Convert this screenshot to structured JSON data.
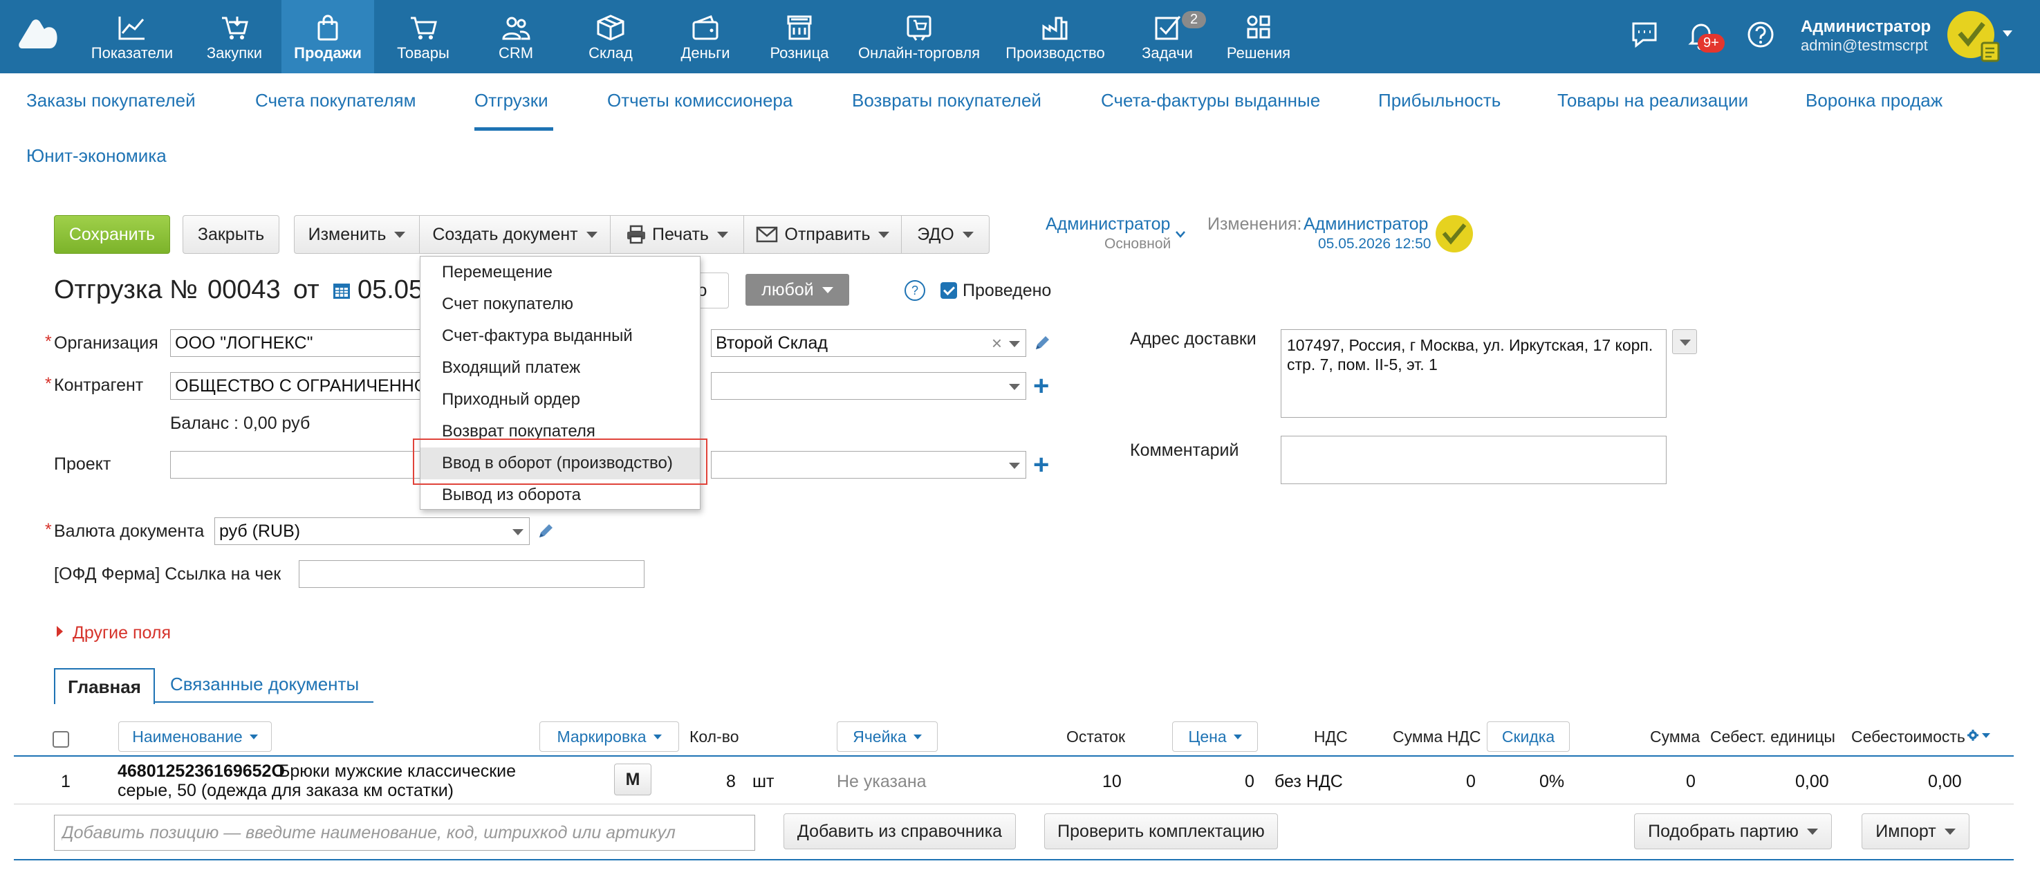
{
  "topnav": {
    "items": [
      {
        "label": "Показатели",
        "icon": "chart-line-icon"
      },
      {
        "label": "Закупки",
        "icon": "cart-arrow-icon"
      },
      {
        "label": "Продажи",
        "icon": "shopping-bag-icon",
        "active": true
      },
      {
        "label": "Товары",
        "icon": "cart-icon"
      },
      {
        "label": "CRM",
        "icon": "users-icon"
      },
      {
        "label": "Склад",
        "icon": "box-icon"
      },
      {
        "label": "Деньги",
        "icon": "wallet-icon"
      },
      {
        "label": "Розница",
        "icon": "store-icon"
      },
      {
        "label": "Онлайн-торговля",
        "icon": "online-store-icon"
      },
      {
        "label": "Производство",
        "icon": "factory-icon"
      },
      {
        "label": "Задачи",
        "icon": "task-check-icon",
        "badge": "2"
      },
      {
        "label": "Решения",
        "icon": "apps-grid-icon"
      }
    ],
    "notifications_badge": "9+",
    "user": {
      "name": "Администратор",
      "email": "admin@testmscrpt"
    },
    "colors": {
      "bar": "#1f6fa4",
      "active": "#2f84bd",
      "badge_red": "#e4362e"
    }
  },
  "subnav": {
    "items": [
      "Заказы покупателей",
      "Счета покупателям",
      "Отгрузки",
      "Отчеты комиссионера",
      "Возвраты покупателей",
      "Счета-фактуры выданные",
      "Прибыльность",
      "Товары на реализации",
      "Воронка продаж",
      "Юнит-экономика"
    ],
    "active": "Отгрузки"
  },
  "toolbar": {
    "save": "Сохранить",
    "close": "Закрыть",
    "edit": "Изменить",
    "create_doc": "Создать документ",
    "print": "Печать",
    "send": "Отправить",
    "edo": "ЭДО"
  },
  "owner": {
    "name": "Администратор",
    "role": "Основной"
  },
  "changes": {
    "label": "Изменения:",
    "name": "Администратор",
    "date": "05.05.2026 12:50"
  },
  "doc": {
    "title": "Отгрузка №",
    "number": "00043",
    "from": "от",
    "date": "05.05",
    "partial_button": "но",
    "status": "любой",
    "posted_label": "Проведено",
    "posted": true
  },
  "form": {
    "org_label": "Организация",
    "org_value": "ООО \"ЛОГНЕКС\"",
    "warehouse_value": "Второй Склад",
    "contractor_label": "Контрагент",
    "contractor_value": "ОБЩЕСТВО С ОГРАНИЧЕННОЙ",
    "balance": "Баланс : 0,00 руб",
    "project_label": "Проект",
    "currency_label": "Валюта документа",
    "currency_value": "руб (RUB)",
    "ofd_label": "[ОФД Ферма] Ссылка на чек",
    "delivery_label": "Адрес доставки",
    "delivery_value": "107497, Россия, г Москва, ул. Иркутская, 17 корп. стр. 7, пом. II-5, эт. 1",
    "comment_label": "Комментарий",
    "other_fields": "Другие поля"
  },
  "tabs": {
    "main": "Главная",
    "related": "Связанные документы"
  },
  "table": {
    "headers": {
      "name": "Наименование",
      "marking": "Маркировка",
      "qty": "Кол-во",
      "cell": "Ячейка",
      "stock": "Остаток",
      "price": "Цена",
      "vat": "НДС",
      "vat_sum": "Сумма НДС",
      "discount": "Скидка",
      "sum": "Сумма",
      "unit_cost": "Себест. единицы",
      "cost": "Себестоимость"
    },
    "rows": [
      {
        "num": "1",
        "code": "4680125236169652О",
        "name_line1": "Брюки мужские классические",
        "name_line2": "серые, 50 (одежда для заказа км остатки)",
        "marking": "М",
        "qty": "8",
        "unit": "шт",
        "cell": "Не указана",
        "stock": "10",
        "price": "0",
        "vat": "без НДС",
        "vat_sum": "0",
        "discount": "0%",
        "sum": "0",
        "unit_cost": "0,00",
        "cost": "0,00"
      }
    ]
  },
  "bottom": {
    "add_placeholder": "Добавить позицию — введите наименование, код, штрихкод или артикул",
    "add_from_ref": "Добавить из справочника",
    "check_kit": "Проверить комплектацию",
    "pick_batch": "Подобрать партию",
    "import": "Импорт"
  },
  "create_menu": {
    "items": [
      "Перемещение",
      "Счет покупателю",
      "Счет-фактура выданный",
      "Входящий платеж",
      "Приходный ордер",
      "Возврат покупателя",
      "Ввод в оборот (производство)",
      "Вывод из оборота"
    ],
    "hovered": "Ввод в оборот (производство)"
  }
}
